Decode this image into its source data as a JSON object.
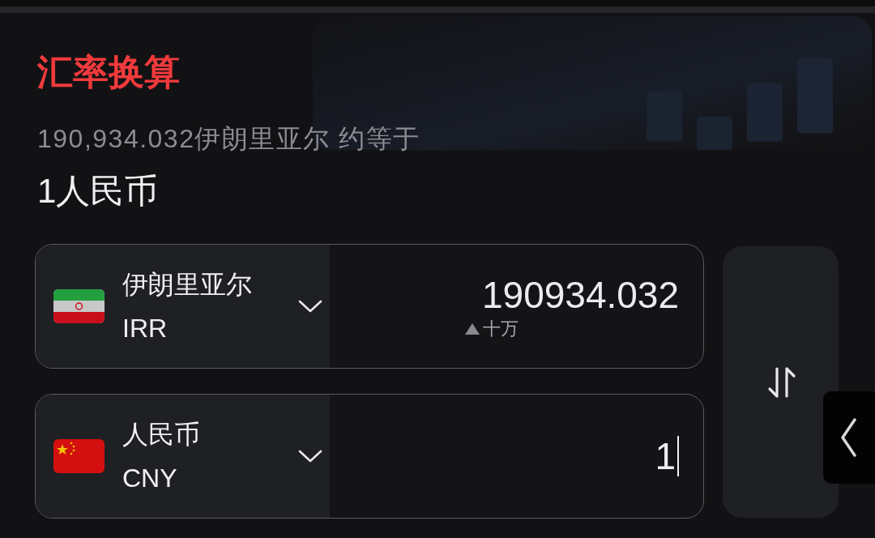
{
  "title": "汇率换算",
  "summary": "190,934.032伊朗里亚尔 约等于",
  "result": "1人民币",
  "rows": [
    {
      "kind": "iran",
      "currency_name": "伊朗里亚尔",
      "code": "IRR",
      "amount": "190934.032",
      "magnitude_hint": "十万",
      "focused": false
    },
    {
      "kind": "china",
      "currency_name": "人民币",
      "code": "CNY",
      "amount": "1",
      "focused": true
    }
  ]
}
